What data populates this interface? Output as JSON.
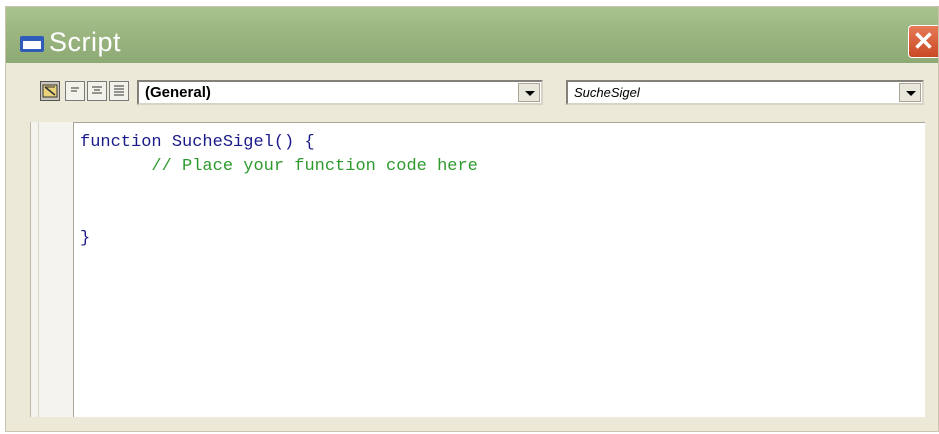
{
  "window": {
    "title": "Script",
    "close_label": "✕"
  },
  "toolbar": {
    "buttons": [
      {
        "name": "object-browser",
        "active": true
      },
      {
        "name": "align-left",
        "active": false
      },
      {
        "name": "align-center",
        "active": false
      },
      {
        "name": "align-justify",
        "active": false
      }
    ]
  },
  "object_select": {
    "value": "(General)"
  },
  "procedure_select": {
    "value": "SucheSigel"
  },
  "editor": {
    "line1_keyword": "function",
    "line1_signature": " SucheSigel() {",
    "line2_comment": "// Place your function code here",
    "line5_brace": "}"
  },
  "colors": {
    "titlebar": "#9db782",
    "comment": "#2e9a2e",
    "keyword": "#1a1a8a",
    "close": "#d35a35"
  }
}
